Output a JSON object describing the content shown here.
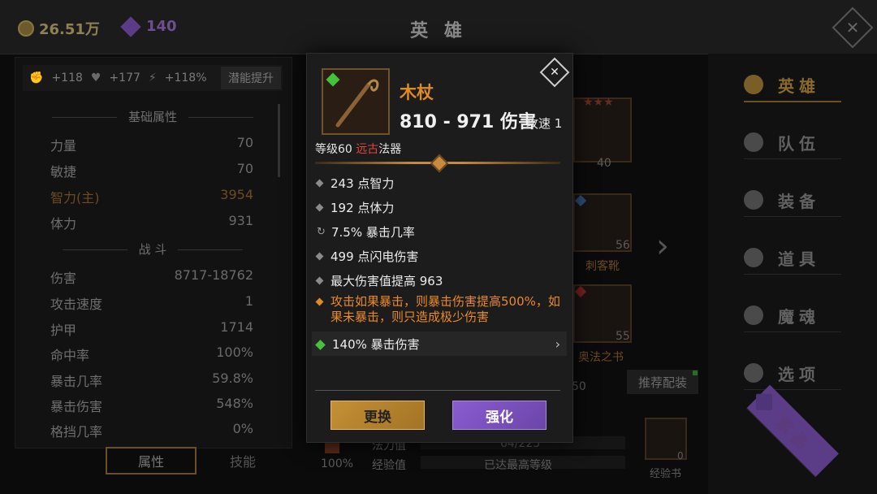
{
  "topbar": {
    "gold": "26.51万",
    "gems": "140",
    "title": "英 雄"
  },
  "left_panel": {
    "buffs": [
      "+118",
      "+177",
      "+118%"
    ],
    "potential_button": "潜能提升",
    "basic_header": "基础属性",
    "basic": [
      {
        "k": "力量",
        "v": "70"
      },
      {
        "k": "敏捷",
        "v": "70"
      },
      {
        "k": "智力(主)",
        "v": "3954"
      },
      {
        "k": "体力",
        "v": "931"
      }
    ],
    "combat_header": "战 斗",
    "combat": [
      {
        "k": "伤害",
        "v": "8717-18762"
      },
      {
        "k": "攻击速度",
        "v": "1"
      },
      {
        "k": "护甲",
        "v": "1714"
      },
      {
        "k": "命中率",
        "v": "100%"
      },
      {
        "k": "暴击几率",
        "v": "59.8%"
      },
      {
        "k": "暴击伤害",
        "v": "548%"
      },
      {
        "k": "格挡几率",
        "v": "0%"
      }
    ],
    "tab_attr": "属性",
    "tab_skill": "技能"
  },
  "background": {
    "slot_level": "40",
    "boots_level": "56",
    "boots_name": "刺客靴",
    "book_level": "55",
    "book_name": "奥法之书",
    "partial_num": "50",
    "recommend": "推荐配装",
    "mana_label": "法力值",
    "mana_value": "64/225",
    "exp_label": "经验值",
    "exp_value": "已达最高等级",
    "exp_book": "经验书",
    "exp_book_count": "0",
    "percent": "100%"
  },
  "right_nav": [
    {
      "label": "英雄",
      "active": true
    },
    {
      "label": "队伍",
      "active": false
    },
    {
      "label": "装备",
      "active": false
    },
    {
      "label": "道具",
      "active": false
    },
    {
      "label": "魔魂",
      "active": false
    },
    {
      "label": "选项",
      "active": false
    },
    {
      "label": "紫晶",
      "active": false
    }
  ],
  "modal": {
    "item_name": "木杖",
    "damage": "810 - 971 伤害",
    "speed": "攻速 1",
    "level_prefix": "等级60 ",
    "rarity": "远古",
    "type": "法器",
    "affixes": [
      "243 点智力",
      "192 点体力",
      "7.5% 暴击几率",
      "499 点闪电伤害",
      "最大伤害值提高 963"
    ],
    "special": "攻击如果暴击，则暴击伤害提高500%，如果未暴击，则只造成极少伤害",
    "gem_affix": "140% 暴击伤害",
    "btn_replace": "更换",
    "btn_enhance": "强化"
  },
  "colors": {
    "gold_accent": "#e08a22",
    "rarity_red": "#e0453a",
    "enhance_purple": "#7a50c0",
    "replace_gold": "#c59036"
  }
}
